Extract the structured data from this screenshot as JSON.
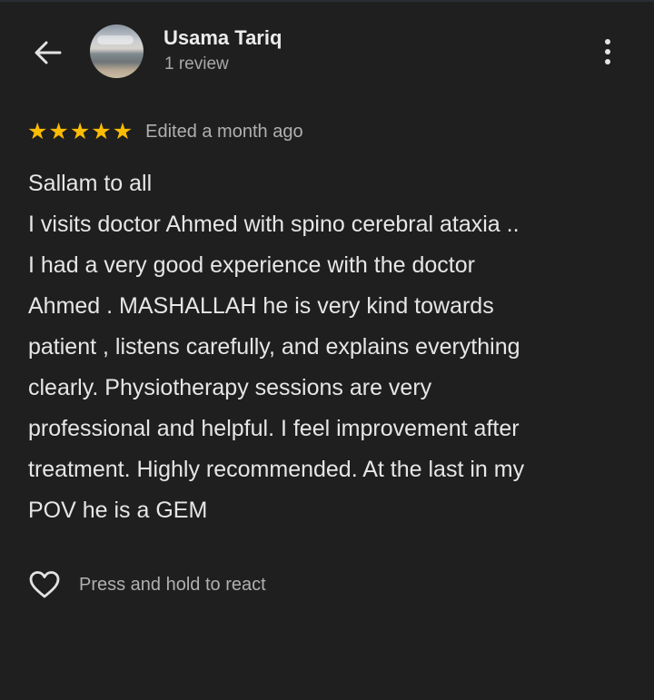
{
  "header": {
    "back_icon": "arrow-left-icon",
    "reviewer_name": "Usama Tariq",
    "review_count": "1 review",
    "more_icon": "more-vert-icon"
  },
  "rating": {
    "stars": 5,
    "max_stars": 5,
    "star_color": "#fbbc04",
    "edited_label": "Edited a month ago"
  },
  "review": {
    "lines": [
      "Sallam to all",
      "I visits doctor Ahmed with spino cerebral ataxia ..",
      "I had a very good experience with the doctor",
      "Ahmed . MASHALLAH he is very kind towards",
      "patient , listens carefully, and explains everything",
      "clearly. Physiotherapy sessions are very",
      "professional and helpful. I feel improvement after",
      "treatment. Highly recommended. At the last in my",
      "POV he is a GEM"
    ]
  },
  "reaction": {
    "icon": "heart-outline-icon",
    "label": "Press and hold to react"
  },
  "colors": {
    "background": "#1f1f1f",
    "text_primary": "#e6e6e6",
    "text_secondary": "#b0b0b0"
  }
}
